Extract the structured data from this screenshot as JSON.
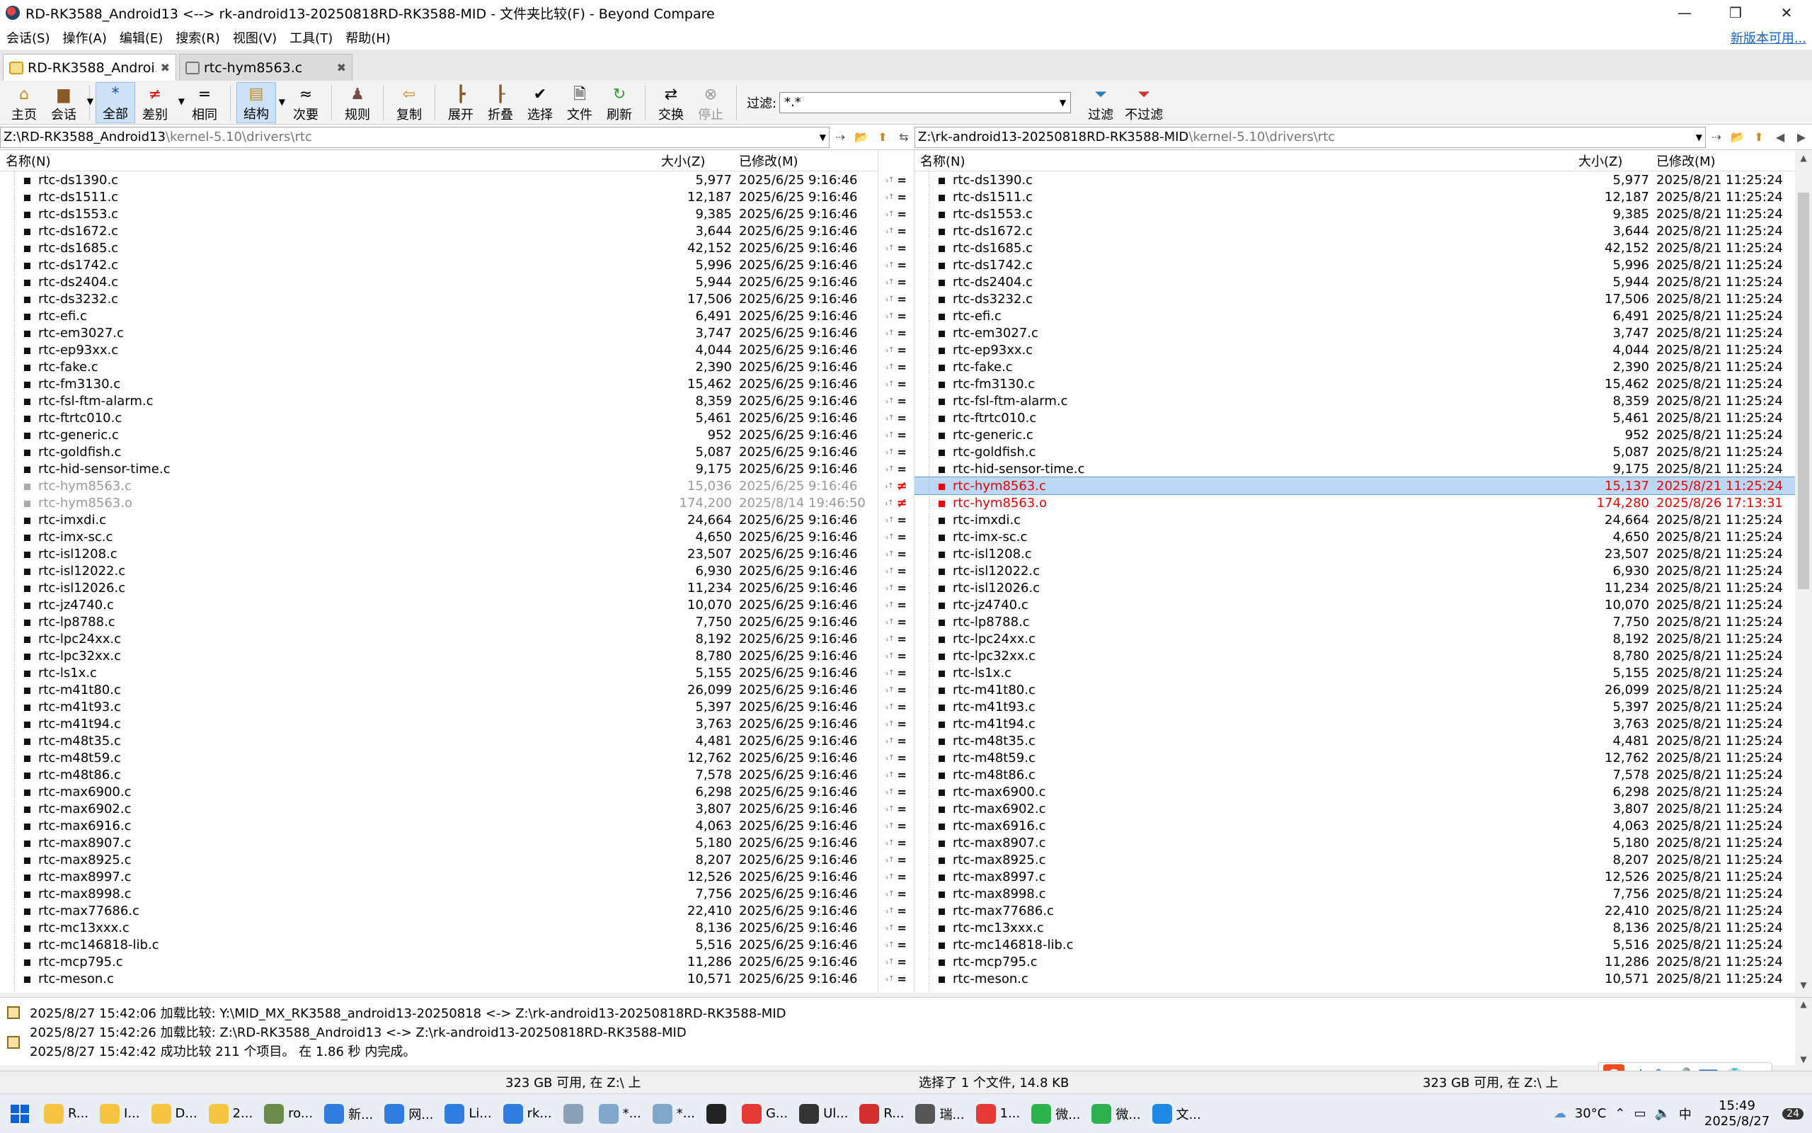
{
  "window": {
    "title": "RD-RK3588_Android13 <--> rk-android13-20250818RD-RK3588-MID - 文件夹比较(F) - Beyond Compare",
    "controls": {
      "minimize": "—",
      "restore": "❐",
      "close": "✕"
    }
  },
  "menu": {
    "items": [
      "会话(S)",
      "操作(A)",
      "编辑(E)",
      "搜索(R)",
      "视图(V)",
      "工具(T)",
      "帮助(H)"
    ],
    "update_link": "新版本可用..."
  },
  "tabs": [
    {
      "label": "RD-RK3588_Androi...",
      "close": "✖"
    },
    {
      "label": "rtc-hym8563.c",
      "close": "✖"
    }
  ],
  "toolbar": {
    "home": "主页",
    "session": "会话",
    "all": "全部",
    "diffs": "差别",
    "same": "相同",
    "structure": "结构",
    "minor": "次要",
    "rules": "规则",
    "copy": "复制",
    "expand": "展开",
    "collapse": "折叠",
    "select": "选择",
    "files": "文件",
    "refresh": "刷新",
    "swap": "交换",
    "stop": "停止",
    "filter_label": "过滤:",
    "filter_value": "*.*",
    "filter": "过滤",
    "no_filter": "不过滤"
  },
  "left": {
    "path_main": "Z:\\RD-RK3588_Android13",
    "path_dim": "\\kernel-5.10\\drivers\\rtc",
    "col_name": "名称(N)",
    "col_size": "大小(Z)",
    "col_date": "已修改(M)"
  },
  "right": {
    "path_main": "Z:\\rk-android13-20250818RD-RK3588-MID",
    "path_dim": "\\kernel-5.10\\drivers\\rtc",
    "col_name": "名称(N)",
    "col_size": "大小(Z)",
    "col_date": "已修改(M)"
  },
  "files": [
    {
      "name": "rtc-ds1390.c",
      "ls": "5,977",
      "ld": "2025/6/25 9:16:46",
      "rs": "5,977",
      "rd": "2025/8/21 11:25:24",
      "state": "same"
    },
    {
      "name": "rtc-ds1511.c",
      "ls": "12,187",
      "ld": "2025/6/25 9:16:46",
      "rs": "12,187",
      "rd": "2025/8/21 11:25:24",
      "state": "same"
    },
    {
      "name": "rtc-ds1553.c",
      "ls": "9,385",
      "ld": "2025/6/25 9:16:46",
      "rs": "9,385",
      "rd": "2025/8/21 11:25:24",
      "state": "same"
    },
    {
      "name": "rtc-ds1672.c",
      "ls": "3,644",
      "ld": "2025/6/25 9:16:46",
      "rs": "3,644",
      "rd": "2025/8/21 11:25:24",
      "state": "same"
    },
    {
      "name": "rtc-ds1685.c",
      "ls": "42,152",
      "ld": "2025/6/25 9:16:46",
      "rs": "42,152",
      "rd": "2025/8/21 11:25:24",
      "state": "same"
    },
    {
      "name": "rtc-ds1742.c",
      "ls": "5,996",
      "ld": "2025/6/25 9:16:46",
      "rs": "5,996",
      "rd": "2025/8/21 11:25:24",
      "state": "same"
    },
    {
      "name": "rtc-ds2404.c",
      "ls": "5,944",
      "ld": "2025/6/25 9:16:46",
      "rs": "5,944",
      "rd": "2025/8/21 11:25:24",
      "state": "same"
    },
    {
      "name": "rtc-ds3232.c",
      "ls": "17,506",
      "ld": "2025/6/25 9:16:46",
      "rs": "17,506",
      "rd": "2025/8/21 11:25:24",
      "state": "same"
    },
    {
      "name": "rtc-efi.c",
      "ls": "6,491",
      "ld": "2025/6/25 9:16:46",
      "rs": "6,491",
      "rd": "2025/8/21 11:25:24",
      "state": "same"
    },
    {
      "name": "rtc-em3027.c",
      "ls": "3,747",
      "ld": "2025/6/25 9:16:46",
      "rs": "3,747",
      "rd": "2025/8/21 11:25:24",
      "state": "same"
    },
    {
      "name": "rtc-ep93xx.c",
      "ls": "4,044",
      "ld": "2025/6/25 9:16:46",
      "rs": "4,044",
      "rd": "2025/8/21 11:25:24",
      "state": "same"
    },
    {
      "name": "rtc-fake.c",
      "ls": "2,390",
      "ld": "2025/6/25 9:16:46",
      "rs": "2,390",
      "rd": "2025/8/21 11:25:24",
      "state": "same"
    },
    {
      "name": "rtc-fm3130.c",
      "ls": "15,462",
      "ld": "2025/6/25 9:16:46",
      "rs": "15,462",
      "rd": "2025/8/21 11:25:24",
      "state": "same"
    },
    {
      "name": "rtc-fsl-ftm-alarm.c",
      "ls": "8,359",
      "ld": "2025/6/25 9:16:46",
      "rs": "8,359",
      "rd": "2025/8/21 11:25:24",
      "state": "same"
    },
    {
      "name": "rtc-ftrtc010.c",
      "ls": "5,461",
      "ld": "2025/6/25 9:16:46",
      "rs": "5,461",
      "rd": "2025/8/21 11:25:24",
      "state": "same"
    },
    {
      "name": "rtc-generic.c",
      "ls": "952",
      "ld": "2025/6/25 9:16:46",
      "rs": "952",
      "rd": "2025/8/21 11:25:24",
      "state": "same"
    },
    {
      "name": "rtc-goldfish.c",
      "ls": "5,087",
      "ld": "2025/6/25 9:16:46",
      "rs": "5,087",
      "rd": "2025/8/21 11:25:24",
      "state": "same"
    },
    {
      "name": "rtc-hid-sensor-time.c",
      "ls": "9,175",
      "ld": "2025/6/25 9:16:46",
      "rs": "9,175",
      "rd": "2025/8/21 11:25:24",
      "state": "same"
    },
    {
      "name": "rtc-hym8563.c",
      "ls": "15,036",
      "ld": "2025/6/25 9:16:46",
      "rs": "15,137",
      "rd": "2025/8/21 11:25:24",
      "state": "diff",
      "selected": true
    },
    {
      "name": "rtc-hym8563.o",
      "ls": "174,200",
      "ld": "2025/8/14 19:46:50",
      "rs": "174,280",
      "rd": "2025/8/26 17:13:31",
      "state": "diff"
    },
    {
      "name": "rtc-imxdi.c",
      "ls": "24,664",
      "ld": "2025/6/25 9:16:46",
      "rs": "24,664",
      "rd": "2025/8/21 11:25:24",
      "state": "same"
    },
    {
      "name": "rtc-imx-sc.c",
      "ls": "4,650",
      "ld": "2025/6/25 9:16:46",
      "rs": "4,650",
      "rd": "2025/8/21 11:25:24",
      "state": "same"
    },
    {
      "name": "rtc-isl1208.c",
      "ls": "23,507",
      "ld": "2025/6/25 9:16:46",
      "rs": "23,507",
      "rd": "2025/8/21 11:25:24",
      "state": "same"
    },
    {
      "name": "rtc-isl12022.c",
      "ls": "6,930",
      "ld": "2025/6/25 9:16:46",
      "rs": "6,930",
      "rd": "2025/8/21 11:25:24",
      "state": "same"
    },
    {
      "name": "rtc-isl12026.c",
      "ls": "11,234",
      "ld": "2025/6/25 9:16:46",
      "rs": "11,234",
      "rd": "2025/8/21 11:25:24",
      "state": "same"
    },
    {
      "name": "rtc-jz4740.c",
      "ls": "10,070",
      "ld": "2025/6/25 9:16:46",
      "rs": "10,070",
      "rd": "2025/8/21 11:25:24",
      "state": "same"
    },
    {
      "name": "rtc-lp8788.c",
      "ls": "7,750",
      "ld": "2025/6/25 9:16:46",
      "rs": "7,750",
      "rd": "2025/8/21 11:25:24",
      "state": "same"
    },
    {
      "name": "rtc-lpc24xx.c",
      "ls": "8,192",
      "ld": "2025/6/25 9:16:46",
      "rs": "8,192",
      "rd": "2025/8/21 11:25:24",
      "state": "same"
    },
    {
      "name": "rtc-lpc32xx.c",
      "ls": "8,780",
      "ld": "2025/6/25 9:16:46",
      "rs": "8,780",
      "rd": "2025/8/21 11:25:24",
      "state": "same"
    },
    {
      "name": "rtc-ls1x.c",
      "ls": "5,155",
      "ld": "2025/6/25 9:16:46",
      "rs": "5,155",
      "rd": "2025/8/21 11:25:24",
      "state": "same"
    },
    {
      "name": "rtc-m41t80.c",
      "ls": "26,099",
      "ld": "2025/6/25 9:16:46",
      "rs": "26,099",
      "rd": "2025/8/21 11:25:24",
      "state": "same"
    },
    {
      "name": "rtc-m41t93.c",
      "ls": "5,397",
      "ld": "2025/6/25 9:16:46",
      "rs": "5,397",
      "rd": "2025/8/21 11:25:24",
      "state": "same"
    },
    {
      "name": "rtc-m41t94.c",
      "ls": "3,763",
      "ld": "2025/6/25 9:16:46",
      "rs": "3,763",
      "rd": "2025/8/21 11:25:24",
      "state": "same"
    },
    {
      "name": "rtc-m48t35.c",
      "ls": "4,481",
      "ld": "2025/6/25 9:16:46",
      "rs": "4,481",
      "rd": "2025/8/21 11:25:24",
      "state": "same"
    },
    {
      "name": "rtc-m48t59.c",
      "ls": "12,762",
      "ld": "2025/6/25 9:16:46",
      "rs": "12,762",
      "rd": "2025/8/21 11:25:24",
      "state": "same"
    },
    {
      "name": "rtc-m48t86.c",
      "ls": "7,578",
      "ld": "2025/6/25 9:16:46",
      "rs": "7,578",
      "rd": "2025/8/21 11:25:24",
      "state": "same"
    },
    {
      "name": "rtc-max6900.c",
      "ls": "6,298",
      "ld": "2025/6/25 9:16:46",
      "rs": "6,298",
      "rd": "2025/8/21 11:25:24",
      "state": "same"
    },
    {
      "name": "rtc-max6902.c",
      "ls": "3,807",
      "ld": "2025/6/25 9:16:46",
      "rs": "3,807",
      "rd": "2025/8/21 11:25:24",
      "state": "same"
    },
    {
      "name": "rtc-max6916.c",
      "ls": "4,063",
      "ld": "2025/6/25 9:16:46",
      "rs": "4,063",
      "rd": "2025/8/21 11:25:24",
      "state": "same"
    },
    {
      "name": "rtc-max8907.c",
      "ls": "5,180",
      "ld": "2025/6/25 9:16:46",
      "rs": "5,180",
      "rd": "2025/8/21 11:25:24",
      "state": "same"
    },
    {
      "name": "rtc-max8925.c",
      "ls": "8,207",
      "ld": "2025/6/25 9:16:46",
      "rs": "8,207",
      "rd": "2025/8/21 11:25:24",
      "state": "same"
    },
    {
      "name": "rtc-max8997.c",
      "ls": "12,526",
      "ld": "2025/6/25 9:16:46",
      "rs": "12,526",
      "rd": "2025/8/21 11:25:24",
      "state": "same"
    },
    {
      "name": "rtc-max8998.c",
      "ls": "7,756",
      "ld": "2025/6/25 9:16:46",
      "rs": "7,756",
      "rd": "2025/8/21 11:25:24",
      "state": "same"
    },
    {
      "name": "rtc-max77686.c",
      "ls": "22,410",
      "ld": "2025/6/25 9:16:46",
      "rs": "22,410",
      "rd": "2025/8/21 11:25:24",
      "state": "same"
    },
    {
      "name": "rtc-mc13xxx.c",
      "ls": "8,136",
      "ld": "2025/6/25 9:16:46",
      "rs": "8,136",
      "rd": "2025/8/21 11:25:24",
      "state": "same"
    },
    {
      "name": "rtc-mc146818-lib.c",
      "ls": "5,516",
      "ld": "2025/6/25 9:16:46",
      "rs": "5,516",
      "rd": "2025/8/21 11:25:24",
      "state": "same"
    },
    {
      "name": "rtc-mcp795.c",
      "ls": "11,286",
      "ld": "2025/6/25 9:16:46",
      "rs": "11,286",
      "rd": "2025/8/21 11:25:24",
      "state": "same"
    },
    {
      "name": "rtc-meson.c",
      "ls": "10,571",
      "ld": "2025/6/25 9:16:46",
      "rs": "10,571",
      "rd": "2025/8/21 11:25:24",
      "state": "same"
    }
  ],
  "center": {
    "eq": "=",
    "ne": "≠",
    "mark": "₁↑"
  },
  "log": [
    "2025/8/27 15:42:06  加载比较: Y:\\MID_MX_RK3588_android13-20250818 <-> Z:\\rk-android13-20250818RD-RK3588-MID",
    "2025/8/27 15:42:26  加载比较: Z:\\RD-RK3588_Android13 <-> Z:\\rk-android13-20250818RD-RK3588-MID",
    "2025/8/27 15:42:42  成功比较 211 个项目。 在 1.86 秒 内完成。"
  ],
  "status": {
    "left_free": "323 GB 可用, 在 Z:\\ 上",
    "selection": "选择了 1 个文件, 14.8 KB",
    "right_free": "323 GB 可用, 在 Z:\\ 上"
  },
  "ime": {
    "lang": "中",
    "punct": "°,"
  },
  "taskbar": {
    "apps": [
      {
        "label": "R...",
        "color": "#f5c542"
      },
      {
        "label": "I...",
        "color": "#f5c542"
      },
      {
        "label": "D...",
        "color": "#f5c542"
      },
      {
        "label": "2...",
        "color": "#f5c542"
      },
      {
        "label": "ro...",
        "color": "#6a8a4a"
      },
      {
        "label": "新...",
        "color": "#2f7de1"
      },
      {
        "label": "网...",
        "color": "#2f7de1"
      },
      {
        "label": "Li...",
        "color": "#2f7de1"
      },
      {
        "label": "rk...",
        "color": "#2f7de1"
      },
      {
        "label": "",
        "color": "#8aa0b8"
      },
      {
        "label": "*...",
        "color": "#7fa7c9"
      },
      {
        "label": "*...",
        "color": "#7fa7c9"
      },
      {
        "label": "",
        "color": "#222222"
      },
      {
        "label": "G...",
        "color": "#e53935"
      },
      {
        "label": "Ul...",
        "color": "#333333"
      },
      {
        "label": "R...",
        "color": "#d32f2f"
      },
      {
        "label": "瑞...",
        "color": "#555555"
      },
      {
        "label": "1...",
        "color": "#e53935"
      },
      {
        "label": "微...",
        "color": "#2bb24c"
      },
      {
        "label": "微...",
        "color": "#2bb24c"
      },
      {
        "label": "文...",
        "color": "#1e88e5"
      }
    ],
    "weather": "30°C",
    "time": "15:49",
    "date": "2025/8/27",
    "notif": "24"
  }
}
